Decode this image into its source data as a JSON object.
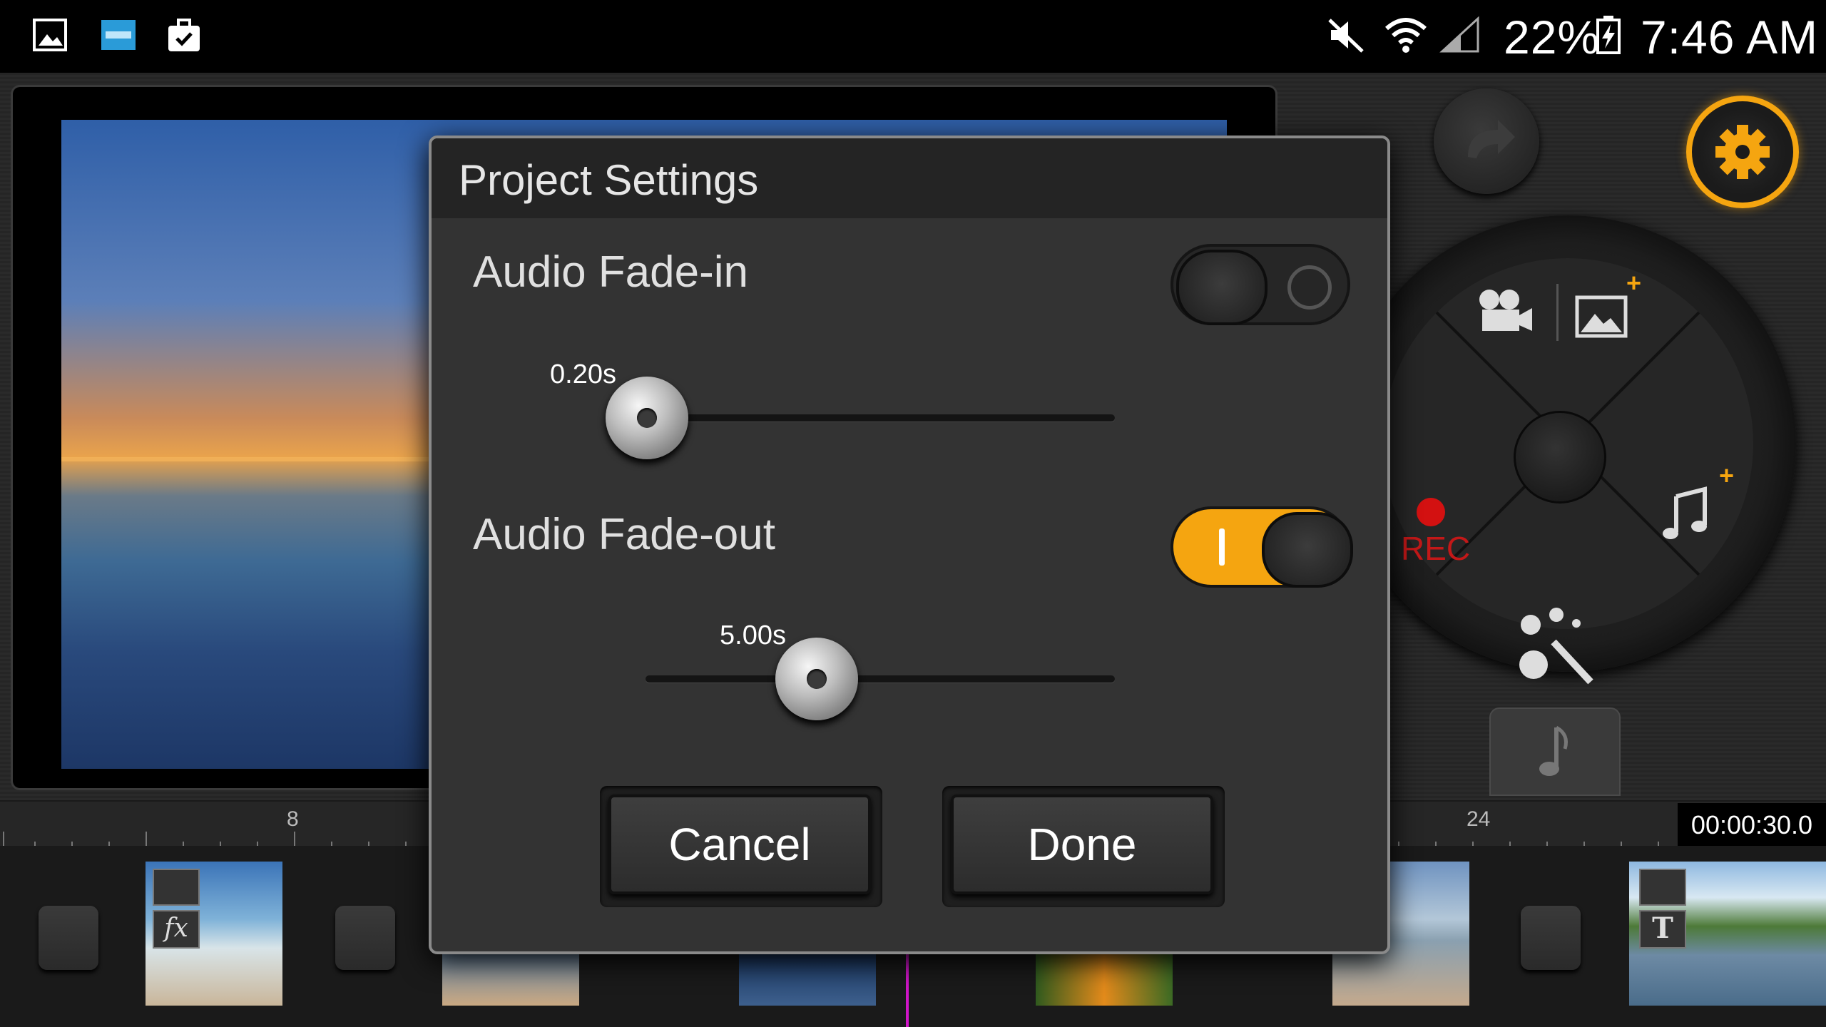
{
  "status_bar": {
    "battery": "22%",
    "time": "7:46 AM",
    "icons": [
      "gallery-icon",
      "app-icon",
      "briefcase-icon",
      "mute-icon",
      "wifi-icon",
      "signal-icon",
      "battery-charging-icon"
    ]
  },
  "dialog": {
    "title": "Project Settings",
    "fade_in": {
      "label": "Audio Fade-in",
      "enabled": false,
      "value_label": "0.20s",
      "value_fraction": 0.0
    },
    "fade_out": {
      "label": "Audio Fade-out",
      "enabled": true,
      "value_label": "5.00s",
      "value_fraction": 0.35
    },
    "cancel_label": "Cancel",
    "done_label": "Done"
  },
  "controls": {
    "rec_label": "REC",
    "accent_color": "#f5a510"
  },
  "timeline": {
    "ruler_labels": [
      "8",
      "24"
    ],
    "timecode": "00:00:30.0"
  }
}
